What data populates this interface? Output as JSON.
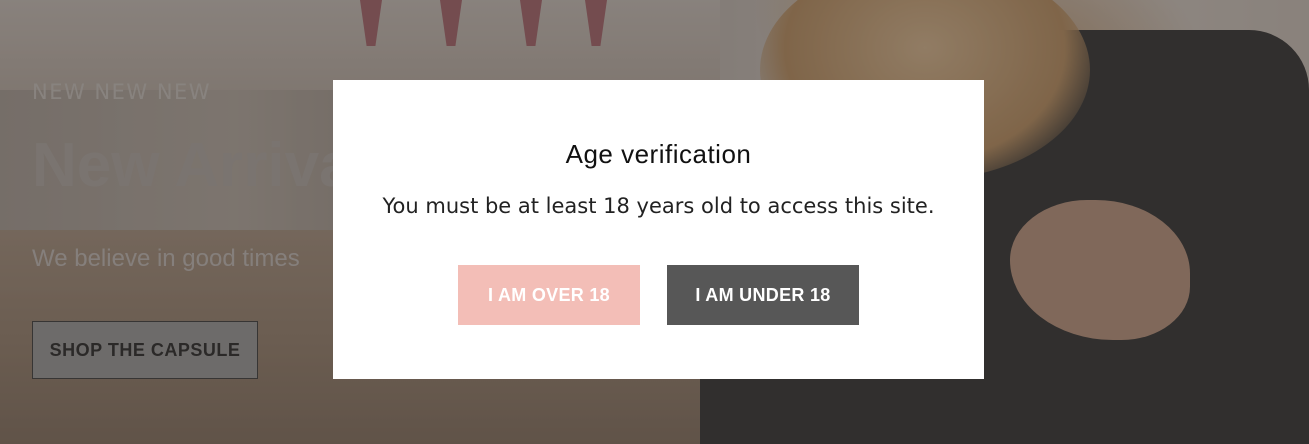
{
  "hero": {
    "eyebrow": "NEW NEW NEW",
    "title": "New Arriva",
    "subtitle": "We believe in good times",
    "cta_label": "SHOP THE CAPSULE"
  },
  "modal": {
    "title": "Age verification",
    "message": "You must be at least 18 years old to access this site.",
    "over_label": "I AM OVER 18",
    "under_label": "I AM UNDER 18"
  },
  "colors": {
    "over_button": "#f3beb7",
    "under_button": "#575757",
    "overlay": "rgba(40,36,34,0.45)"
  }
}
